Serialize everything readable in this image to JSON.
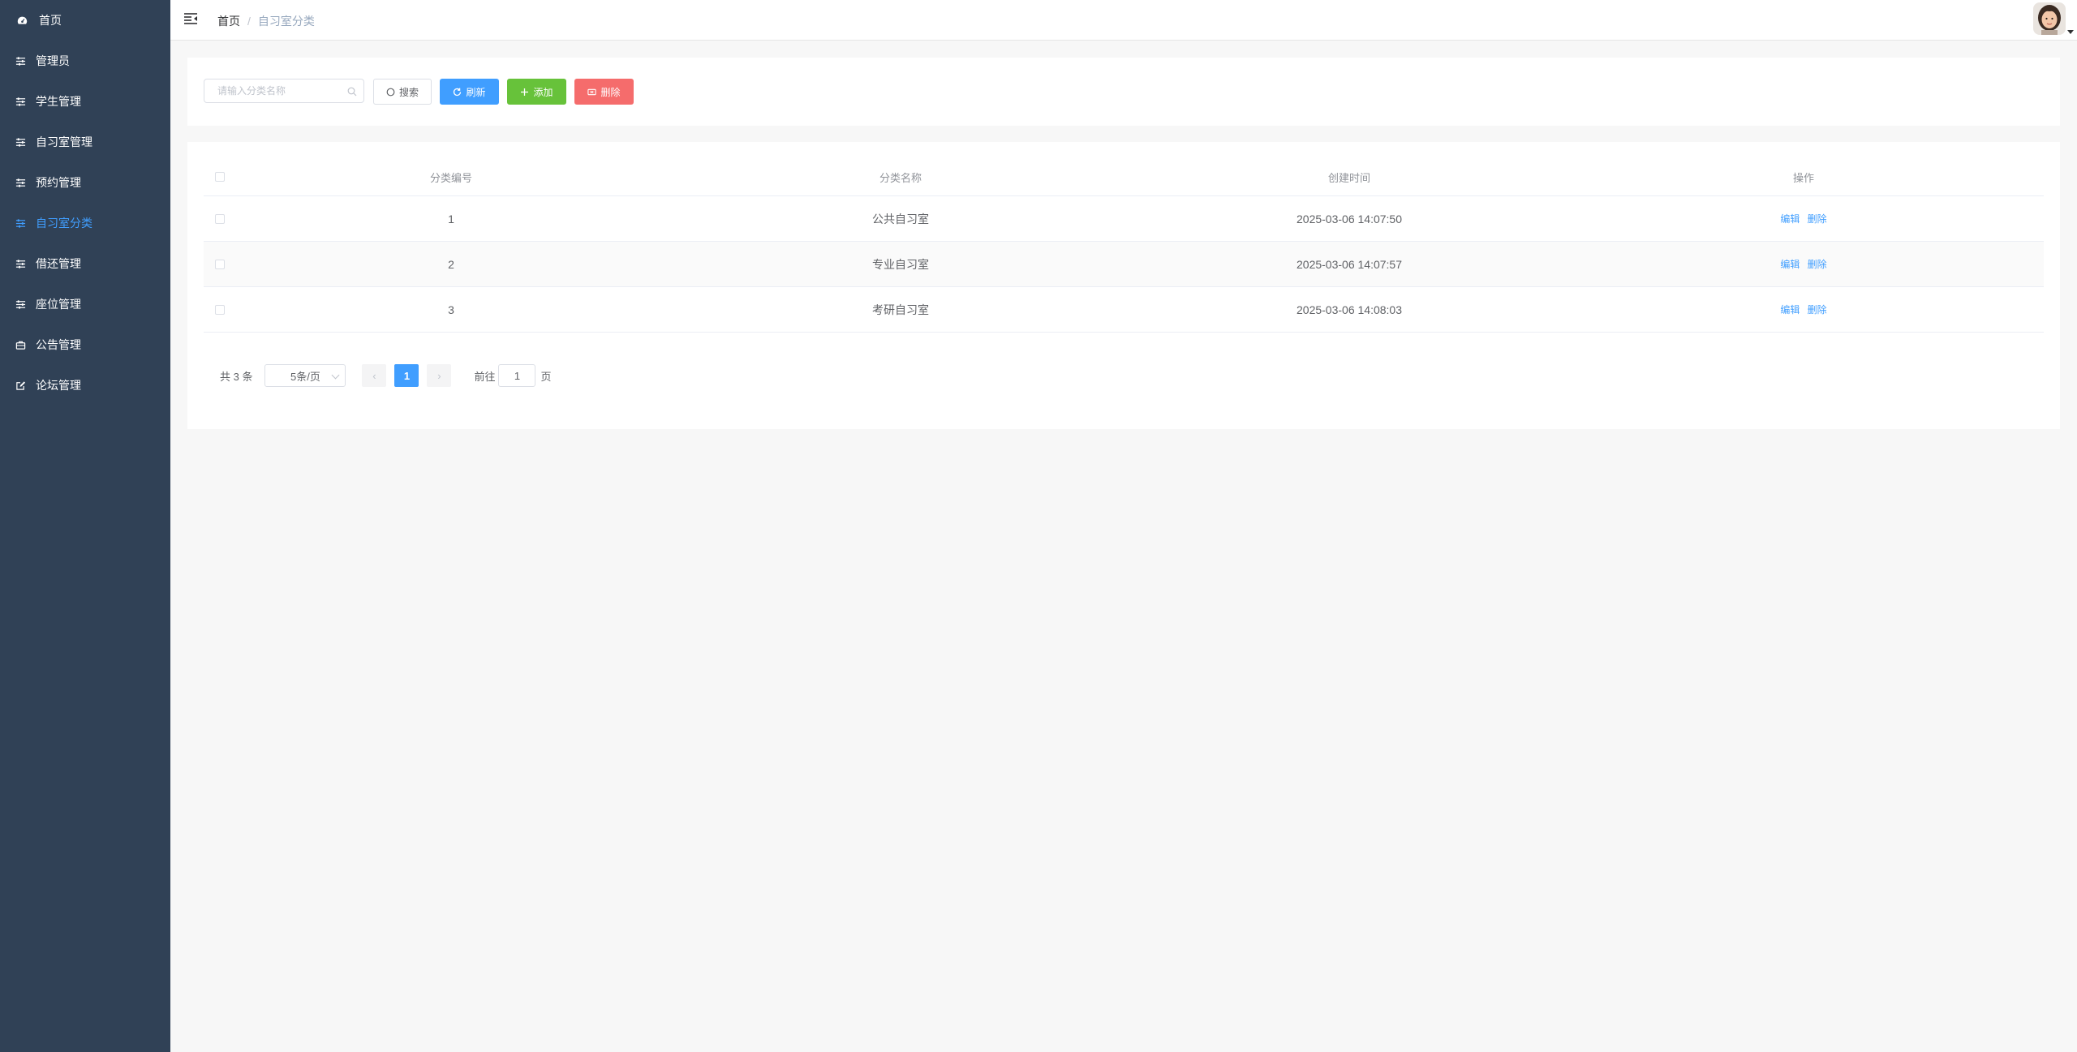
{
  "sidebar": {
    "items": [
      {
        "label": "首页",
        "icon": "dashboard-icon",
        "active": false
      },
      {
        "label": "管理员",
        "icon": "sliders-icon",
        "active": false
      },
      {
        "label": "学生管理",
        "icon": "sliders-icon",
        "active": false
      },
      {
        "label": "自习室管理",
        "icon": "sliders-icon",
        "active": false
      },
      {
        "label": "预约管理",
        "icon": "sliders-icon",
        "active": false
      },
      {
        "label": "自习室分类",
        "icon": "sliders-icon",
        "active": true
      },
      {
        "label": "借还管理",
        "icon": "sliders-icon",
        "active": false
      },
      {
        "label": "座位管理",
        "icon": "sliders-icon",
        "active": false
      },
      {
        "label": "公告管理",
        "icon": "briefcase-icon",
        "active": false
      },
      {
        "label": "论坛管理",
        "icon": "edit-icon",
        "active": false
      }
    ]
  },
  "header": {
    "breadcrumb_home": "首页",
    "breadcrumb_sep": "/",
    "breadcrumb_current": "自习室分类"
  },
  "toolbar": {
    "search_placeholder": "请输入分类名称",
    "search_label": "搜索",
    "refresh_label": "刷新",
    "add_label": "添加",
    "delete_label": "删除"
  },
  "table": {
    "columns": [
      "分类编号",
      "分类名称",
      "创建时间",
      "操作"
    ],
    "rows": [
      {
        "id": "1",
        "name": "公共自习室",
        "created": "2025-03-06 14:07:50"
      },
      {
        "id": "2",
        "name": "专业自习室",
        "created": "2025-03-06 14:07:57"
      },
      {
        "id": "3",
        "name": "考研自习室",
        "created": "2025-03-06 14:08:03"
      }
    ],
    "edit_label": "编辑",
    "delete_label": "删除"
  },
  "pagination": {
    "total_text": "共 3 条",
    "page_size": "5条/页",
    "current_page": "1",
    "goto_label": "前往",
    "goto_value": "1",
    "page_suffix": "页"
  },
  "colors": {
    "sidebar_bg": "#304156",
    "active": "#409eff",
    "success": "#67c23a",
    "danger": "#f56c6c"
  }
}
